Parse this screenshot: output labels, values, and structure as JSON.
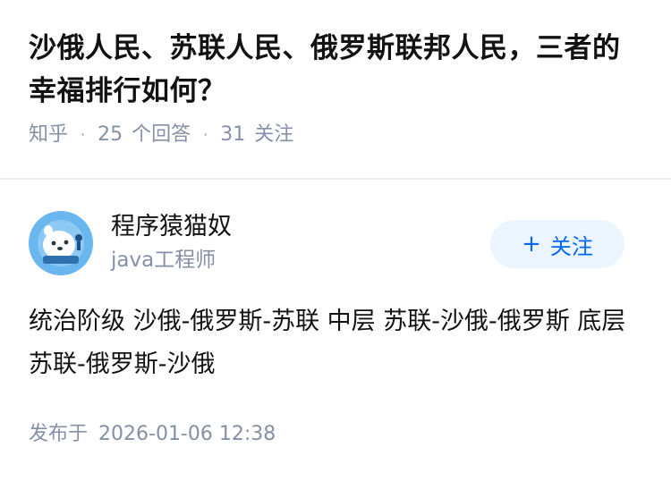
{
  "question": {
    "title": "沙俄人民、苏联人民、俄罗斯联邦人民，三者的幸福排行如何？",
    "source": "知乎",
    "answers_count": "25",
    "answers_label": "个回答",
    "followers_count": "31",
    "followers_label": "关注"
  },
  "author": {
    "name": "程序猿猫奴",
    "bio": "java工程师",
    "avatar_icon": "avatar-seal-astronaut",
    "follow_plus": "+",
    "follow_label": "关注"
  },
  "answer": {
    "content": "统治阶级 沙俄-俄罗斯-苏联 中层 苏联-沙俄-俄罗斯 底层 苏联-俄罗斯-沙俄",
    "published_label": "发布于",
    "published_time": "2026-01-06 12:38"
  },
  "colors": {
    "accent": "#0066ff",
    "follow_bg": "#ebf5ff",
    "meta_text": "#8590a6",
    "avatar_bg": "#69b7ee"
  }
}
